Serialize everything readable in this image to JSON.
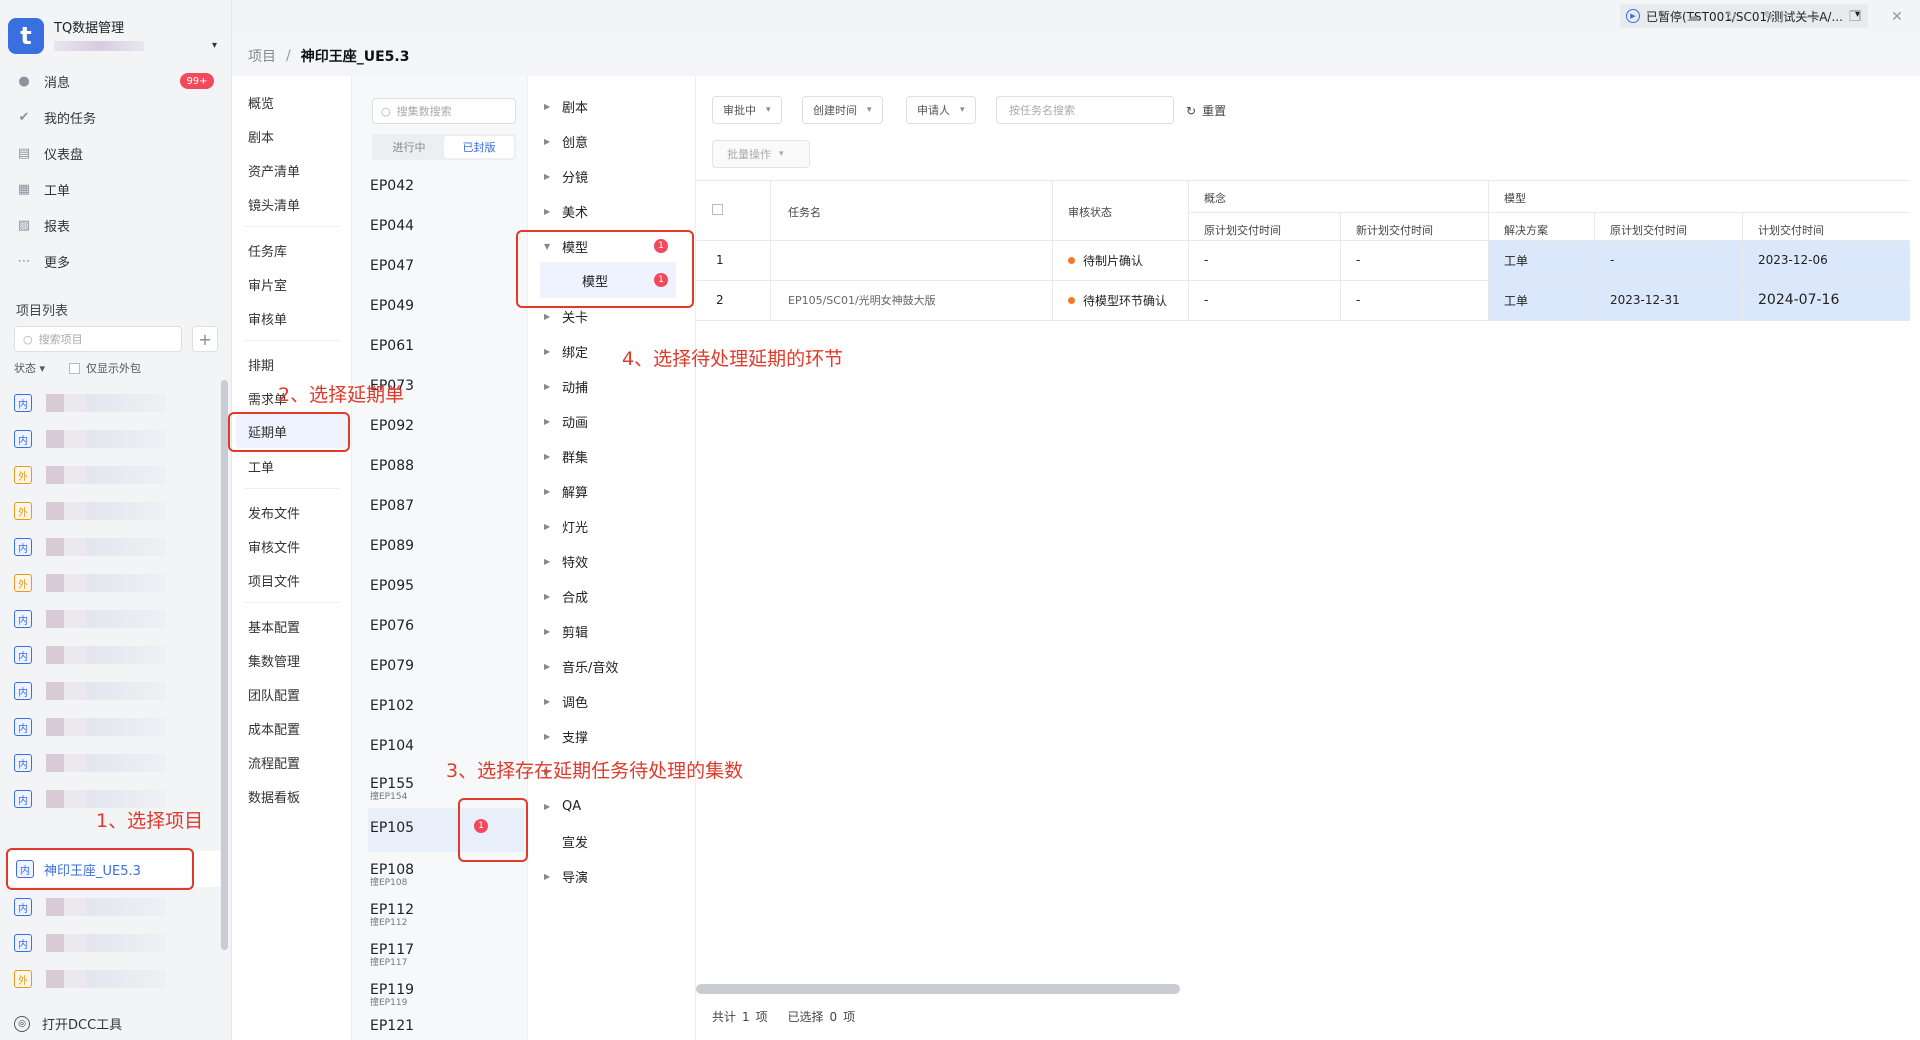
{
  "brand": {
    "logo": "t",
    "title": "TQ数据管理"
  },
  "nav": [
    {
      "label": "消息",
      "icon": "message-icon",
      "badge": "99+"
    },
    {
      "label": "我的任务",
      "icon": "check-icon"
    },
    {
      "label": "仪表盘",
      "icon": "dashboard-icon"
    },
    {
      "label": "工单",
      "icon": "ticket-icon"
    },
    {
      "label": "报表",
      "icon": "report-icon"
    },
    {
      "label": "更多",
      "icon": "more-icon"
    }
  ],
  "project_list": {
    "label": "项目列表",
    "search_placeholder": "搜索项目",
    "add": "+",
    "status_label": "状态",
    "only_external": "仅显示外包",
    "tags": [
      "内",
      "内",
      "外",
      "外",
      "内",
      "外",
      "内",
      "内",
      "内",
      "内",
      "内",
      "内"
    ],
    "selected": {
      "tag": "内",
      "name": "神印王座_UE5.3"
    },
    "tags_after": [
      "内",
      "内",
      "外"
    ]
  },
  "dcc": "打开DCC工具",
  "topbar": {
    "paused_text": "已暂停(TST001/SC01/测试关卡A/...",
    "caret": "▾"
  },
  "breadcrumb": {
    "root": "项目",
    "sep": "/",
    "current": "神印王座_UE5.3"
  },
  "subnav": {
    "group1": [
      "概览",
      "剧本",
      "资产清单",
      "镜头清单"
    ],
    "group2": [
      "任务库",
      "审片室",
      "审核单"
    ],
    "group3": [
      "排期",
      "需求单",
      "延期单",
      "工单"
    ],
    "group4": [
      "发布文件",
      "审核文件",
      "项目文件"
    ],
    "group5": [
      "基本配置",
      "集数管理",
      "团队配置",
      "成本配置",
      "流程配置",
      "数据看板"
    ]
  },
  "episodes": {
    "search_placeholder": "搜集数搜索",
    "tab_active": "已封版",
    "tab_inactive": "进行中",
    "items": [
      "EP042",
      "EP044",
      "EP047",
      "EP049",
      "EP061",
      "EP073",
      "EP092",
      "EP088",
      "EP087",
      "EP089",
      "EP095",
      "EP076",
      "EP079",
      "EP102",
      "EP104"
    ],
    "items2": [
      {
        "name": "EP155",
        "sub": "撞EP154"
      },
      {
        "name": "EP105",
        "sub": ""
      },
      {
        "name": "EP108",
        "sub": "撞EP108"
      },
      {
        "name": "EP112",
        "sub": "撞EP112"
      },
      {
        "name": "EP117",
        "sub": "撞EP117"
      },
      {
        "name": "EP119",
        "sub": "撞EP119"
      },
      {
        "name": "EP121",
        "sub": ""
      }
    ],
    "badge": "1"
  },
  "stages": {
    "items": [
      "剧本",
      "创意",
      "分镜",
      "美术"
    ],
    "model": "模型",
    "model_child": "模型",
    "badge": "1",
    "items_after": [
      "关卡",
      "绑定",
      "动捕",
      "动画",
      "群集",
      "解算",
      "灯光",
      "特效",
      "合成",
      "剪辑",
      "音乐/音效",
      "调色",
      "支撑",
      "",
      "QA",
      "宣发",
      "导演"
    ]
  },
  "filters": {
    "reviewing": "审批中",
    "created_time": "创建时间",
    "applicant": "申请人",
    "task_search_placeholder": "按任务名搜索",
    "reset": "重置",
    "batch": "批量操作"
  },
  "table": {
    "col_task": "任务名",
    "col_status": "审核状态",
    "group_concept": "概念",
    "group_model": "模型",
    "sub_orig": "原计划交付时间",
    "sub_new": "新计划交付时间",
    "sub_solution": "解决方案",
    "sub_orig2": "原计划交付时间",
    "sub_plan": "计划交付时间",
    "rows": [
      {
        "no": "1",
        "task": "",
        "status": "待制片确认",
        "c_orig": "-",
        "c_new": "-",
        "solution": "工单",
        "m_orig": "-",
        "m_plan": "2023-12-06"
      },
      {
        "no": "2",
        "task": "EP105/SC01/光明女神鼓大版",
        "status": "待模型环节确认",
        "c_orig": "-",
        "c_new": "-",
        "solution": "工单",
        "m_orig": "2023-12-31",
        "m_plan": "2024-07-16"
      }
    ]
  },
  "footer": {
    "total_label": "共计",
    "total": "1",
    "unit": "项",
    "selected_label": "已选择",
    "selected": "0",
    "unit2": "项"
  },
  "annotations": {
    "a1": "1、选择项目",
    "a2": "2、选择延期单",
    "a3": "3、选择存在延期任务待处理的集数",
    "a4": "4、选择待处理延期的环节"
  }
}
